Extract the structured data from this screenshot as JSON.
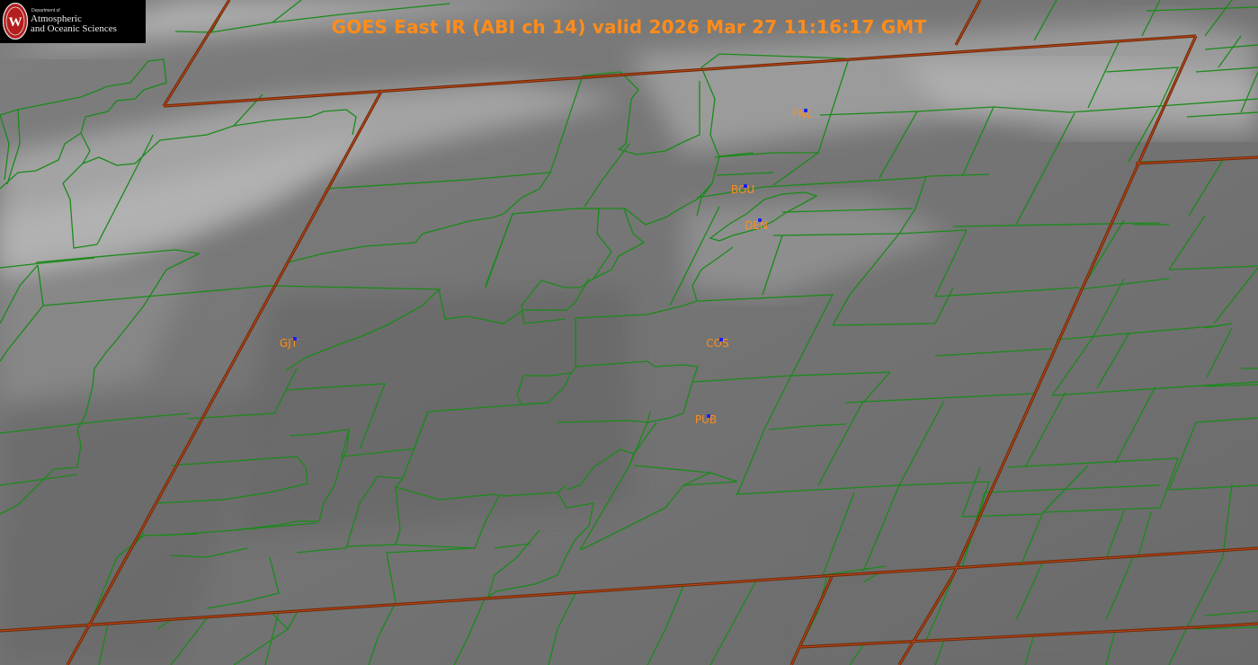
{
  "header": {
    "title": "GOES East IR (ABI ch 14) valid 2026 Mar 27 11:16:17 GMT"
  },
  "logo": {
    "line1": "Department of",
    "line2": "Atmospheric",
    "line3": "and Oceanic Sciences",
    "letter": "W"
  },
  "stations": [
    {
      "id": "FNL"
    },
    {
      "id": "BOU"
    },
    {
      "id": "DEN"
    },
    {
      "id": "GJT"
    },
    {
      "id": "COS"
    },
    {
      "id": "PUB"
    }
  ],
  "colors": {
    "county_lines": "#1a8a1a",
    "state_lines": "#8a3a10",
    "station_labels": "#ff8c1a",
    "station_marker": "#1a1aff",
    "logo_red": "#b41e1e"
  }
}
